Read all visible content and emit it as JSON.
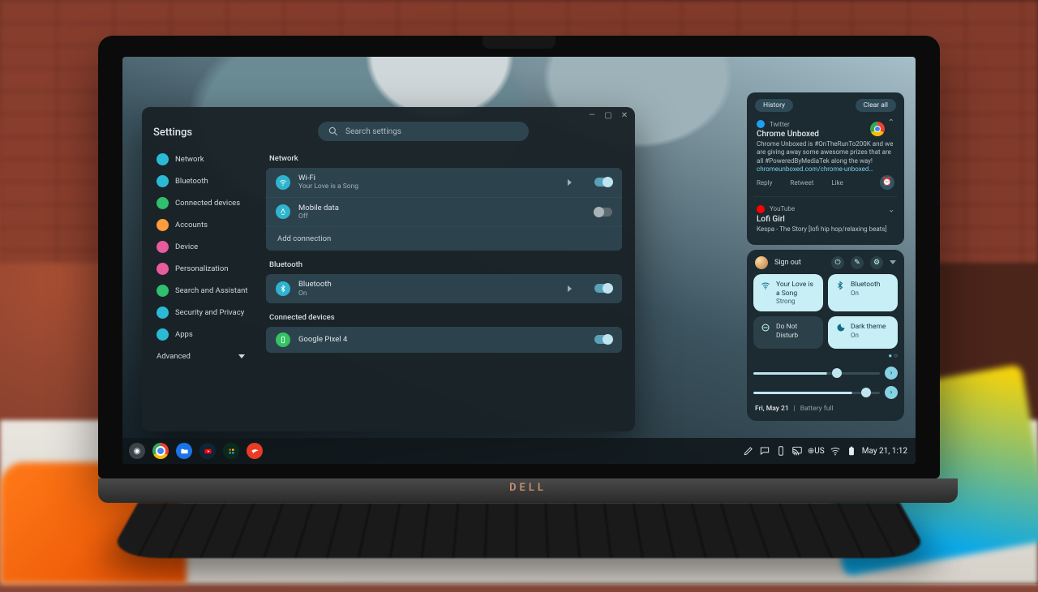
{
  "laptop_brand": "DELL",
  "shelf": {
    "status": {
      "ime": "⊕US",
      "time": "May 21, 1:12"
    }
  },
  "settings": {
    "title": "Settings",
    "search_placeholder": "Search settings",
    "sidebar": [
      {
        "label": "Network",
        "color": "#2bbad6"
      },
      {
        "label": "Bluetooth",
        "color": "#2bbad6"
      },
      {
        "label": "Connected devices",
        "color": "#2fbf6e"
      },
      {
        "label": "Accounts",
        "color": "#ff9c3b"
      },
      {
        "label": "Device",
        "color": "#e85b9d"
      },
      {
        "label": "Personalization",
        "color": "#e85b9d"
      },
      {
        "label": "Search and Assistant",
        "color": "#2fbf6e"
      },
      {
        "label": "Security and Privacy",
        "color": "#2bbad6"
      },
      {
        "label": "Apps",
        "color": "#2bbad6"
      }
    ],
    "advanced": "Advanced",
    "sections": {
      "network_head": "Network",
      "wifi": {
        "title": "Wi-Fi",
        "sub": "Your Love is a  Song",
        "color": "#2fb4cf",
        "on": true,
        "expand": true
      },
      "mobile": {
        "title": "Mobile data",
        "sub": "Off",
        "color": "#2fb4cf",
        "on": false,
        "expand": false
      },
      "add": "Add connection",
      "bt_head": "Bluetooth",
      "bt": {
        "title": "Bluetooth",
        "sub": "On",
        "color": "#2fb4cf",
        "on": true,
        "expand": true
      },
      "cd_head": "Connected devices",
      "pixel": {
        "title": "Google Pixel 4",
        "color": "#34c263",
        "on": true
      }
    }
  },
  "notifications": {
    "history": "History",
    "clear": "Clear all",
    "twitter": {
      "source": "Twitter",
      "title": "Chrome Unboxed",
      "body_plain": "Chrome Unboxed is #OnTheRunTo200K and we are giving away some awesome prizes that are all #PoweredByMediaTek along the way!",
      "link": "chromeunboxed.com/chrome-unboxed…",
      "actions": [
        "Reply",
        "Retweet",
        "Like"
      ]
    },
    "youtube": {
      "source": "YouTube",
      "title": "Lofi Girl",
      "body": "Kespa - The Story [lofi hip hop/relaxing beats]"
    }
  },
  "quicksettings": {
    "signout": "Sign out",
    "tiles": {
      "wifi": {
        "title": "Your Love is a Song",
        "sub": "Strong"
      },
      "bt": {
        "title": "Bluetooth",
        "sub": "On"
      },
      "dnd": {
        "title": "Do Not Disturb",
        "sub": ""
      },
      "dark": {
        "title": "Dark theme",
        "sub": "On"
      }
    },
    "brightness": 58,
    "volume": 78,
    "footer_date": "Fri, May 21",
    "footer_batt": "Battery full"
  }
}
